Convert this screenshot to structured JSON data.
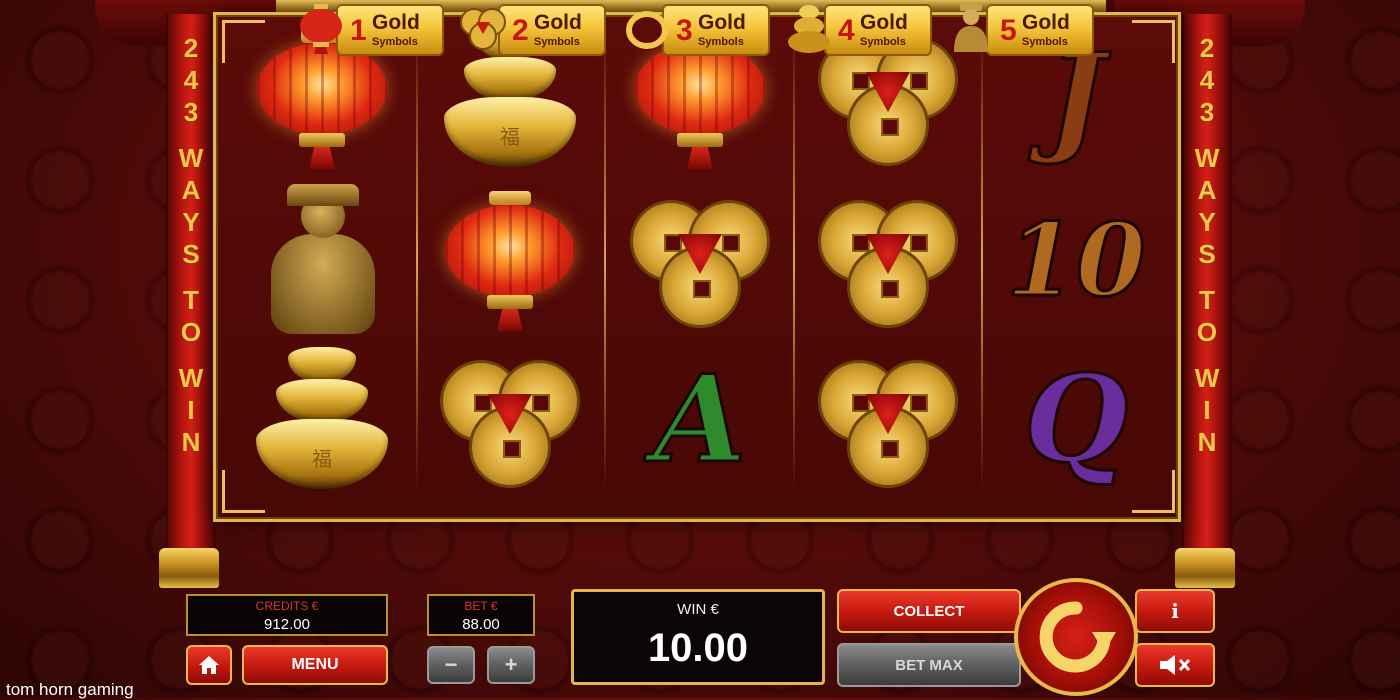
{
  "pillars": {
    "left_text": "243 WAYS TO WIN",
    "right_text": "243 WAYS TO WIN"
  },
  "reels": [
    [
      "lantern",
      "god-of-wealth-statue",
      "gold-ingot"
    ],
    [
      "gold-ingot",
      "lantern",
      "gold-coins"
    ],
    [
      "lantern",
      "gold-coins",
      "A"
    ],
    [
      "gold-coins",
      "gold-coins",
      "gold-coins"
    ],
    [
      "J",
      "10",
      "Q"
    ]
  ],
  "gold_symbols": [
    {
      "number": "1",
      "word": "Gold",
      "sub": "Symbols",
      "icon": "lantern-icon"
    },
    {
      "number": "2",
      "word": "Gold",
      "sub": "Symbols",
      "icon": "coins-icon"
    },
    {
      "number": "3",
      "word": "Gold",
      "sub": "Symbols",
      "icon": "ring-icon"
    },
    {
      "number": "4",
      "word": "Gold",
      "sub": "Symbols",
      "icon": "ingot-icon"
    },
    {
      "number": "5",
      "word": "Gold",
      "sub": "Symbols",
      "icon": "statue-icon"
    }
  ],
  "credits": {
    "label": "CREDITS €",
    "value": "912.00"
  },
  "bet": {
    "label": "BET €",
    "value": "88.00",
    "minus": "−",
    "plus": "+"
  },
  "win": {
    "label": "WIN €",
    "value": "10.00"
  },
  "buttons": {
    "menu": "MENU",
    "collect": "COLLECT",
    "bet_max": "BET MAX",
    "info": "i"
  },
  "icons": {
    "home": "home-icon",
    "spin": "spin-arrow-icon",
    "sound": "speaker-mute-icon"
  },
  "brand": "tom horn gaming",
  "colors": {
    "gold": "#e2b64f",
    "red": "#c71a10",
    "background": "#4e0a08"
  }
}
